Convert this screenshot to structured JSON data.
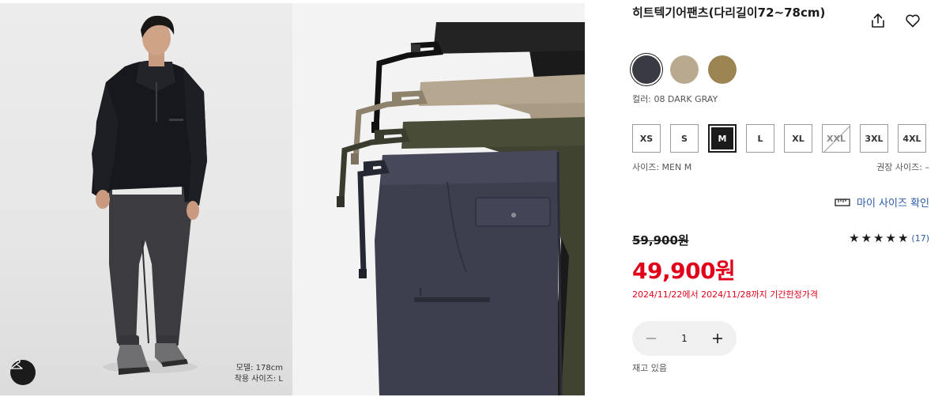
{
  "gallery": {
    "model_info": {
      "height": "모델: 178cm",
      "size": "착용 사이즈: L"
    }
  },
  "product": {
    "title": "히트텍기어팬츠(다리길이72~78cm)",
    "colors": [
      {
        "name": "dark-gray",
        "hex": "#3a3b42",
        "selected": true
      },
      {
        "name": "beige",
        "hex": "#b8a98f",
        "selected": false
      },
      {
        "name": "brown",
        "hex": "#9c8453",
        "selected": false
      }
    ],
    "color_label": "컬러: 08 DARK GRAY",
    "sizes": [
      {
        "label": "XS",
        "state": "available"
      },
      {
        "label": "S",
        "state": "available"
      },
      {
        "label": "M",
        "state": "selected"
      },
      {
        "label": "L",
        "state": "available"
      },
      {
        "label": "XL",
        "state": "available"
      },
      {
        "label": "XXL",
        "state": "soldout"
      },
      {
        "label": "3XL",
        "state": "available"
      },
      {
        "label": "4XL",
        "state": "available"
      }
    ],
    "size_label": "사이즈: MEN M",
    "recommended_size": "권장 사이즈: –",
    "size_guide_link": "마이 사이즈 확인",
    "original_price": "59,900원",
    "rating_stars": 5,
    "review_count": "(17)",
    "sale_price": "49,900원",
    "sale_period": "2024/11/22에서 2024/11/28까지 기간한정가격",
    "quantity": "1",
    "stock_status": "재고 있음"
  },
  "icons": {
    "share": "share-icon",
    "favorite": "heart-icon",
    "ruler": "ruler-icon",
    "hanger": "hanger-icon",
    "minus": "minus-icon",
    "plus": "plus-icon"
  },
  "colors": {
    "sale_red": "#e0001a",
    "link_blue": "#2a5aa8",
    "text": "#1b1b1b"
  }
}
